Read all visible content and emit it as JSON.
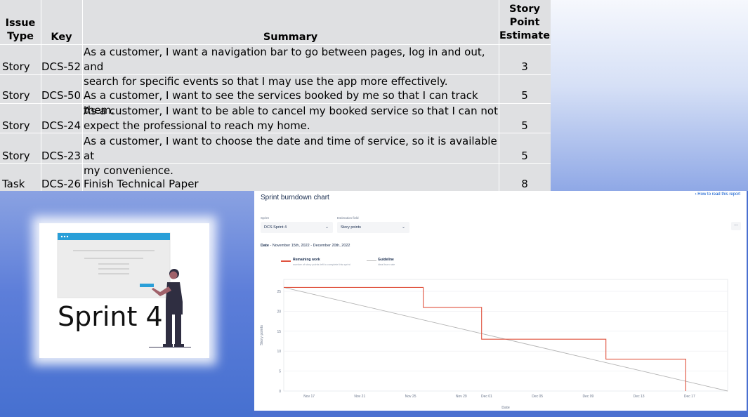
{
  "table": {
    "headers": {
      "issue_type": [
        "Issue",
        "Type"
      ],
      "key": "Key",
      "summary": "Summary",
      "estimate": [
        "Story",
        "Point",
        "Estimate"
      ]
    },
    "rows": [
      {
        "type": "Story",
        "key": "DCS-52",
        "summary": [
          "As a customer, I want a navigation bar to go between pages, log in and out, and",
          "search for specific events so that I may use the app more effectively."
        ],
        "points": "3"
      },
      {
        "type": "Story",
        "key": "DCS-50",
        "summary": [
          "As a customer, I want to see the services booked by me so that I can track them."
        ],
        "points": "5"
      },
      {
        "type": "Story",
        "key": "DCS-24",
        "summary": [
          "As a customer, I want to be able to cancel my booked service so that I can not",
          "expect the professional to reach my home."
        ],
        "points": "5"
      },
      {
        "type": "Story",
        "key": "DCS-23",
        "summary": [
          "As a customer, I want to choose the date and time of service, so it is available at",
          "my convenience."
        ],
        "points": "5"
      },
      {
        "type": "Task",
        "key": "DCS-26",
        "summary": [
          "Finish Technical Paper"
        ],
        "points": "8"
      }
    ]
  },
  "slide": {
    "title": "Sprint 4"
  },
  "report": {
    "title": "Sprint burndown chart",
    "help_link": "How to read this report",
    "sprint_label": "Sprint",
    "sprint_value": "DCS Sprint 4",
    "estimation_label": "Estimation field",
    "estimation_value": "Story points",
    "more_label": "...",
    "date_label": "Date",
    "date_range": "- November 15th, 2022 - December 20th, 2022",
    "legend": {
      "remaining_title": "Remaining work",
      "remaining_sub": "number of story points left to complete this sprint",
      "guideline_title": "Guideline",
      "guideline_sub": "ideal burn rate"
    }
  },
  "colors": {
    "remaining": "#e0533f",
    "guideline": "#b3b3b3",
    "header_bar": "#2a9fd8"
  },
  "chart_data": {
    "type": "line",
    "xlabel": "Date",
    "ylabel": "Story points",
    "ylim": [
      0,
      28
    ],
    "yticks": [
      0,
      5,
      10,
      15,
      20,
      25
    ],
    "xticks": [
      "Nov 17",
      "Nov 21",
      "Nov 25",
      "Nov 29",
      "Dec 01",
      "Dec 05",
      "Dec 09",
      "Dec 13",
      "Dec 17"
    ],
    "xtick_days": [
      2,
      6,
      10,
      14,
      16,
      20,
      24,
      28,
      32
    ],
    "x_range_days": [
      0,
      35
    ],
    "series": [
      {
        "name": "Remaining work",
        "style": "step",
        "points": [
          [
            0,
            26
          ],
          [
            11,
            26
          ],
          [
            11,
            21
          ],
          [
            15.6,
            21
          ],
          [
            15.6,
            13
          ],
          [
            25.4,
            13
          ],
          [
            25.4,
            8
          ],
          [
            31.7,
            8
          ],
          [
            31.7,
            0
          ]
        ]
      },
      {
        "name": "Guideline",
        "style": "line",
        "points": [
          [
            0,
            26
          ],
          [
            35,
            0
          ]
        ]
      }
    ]
  }
}
